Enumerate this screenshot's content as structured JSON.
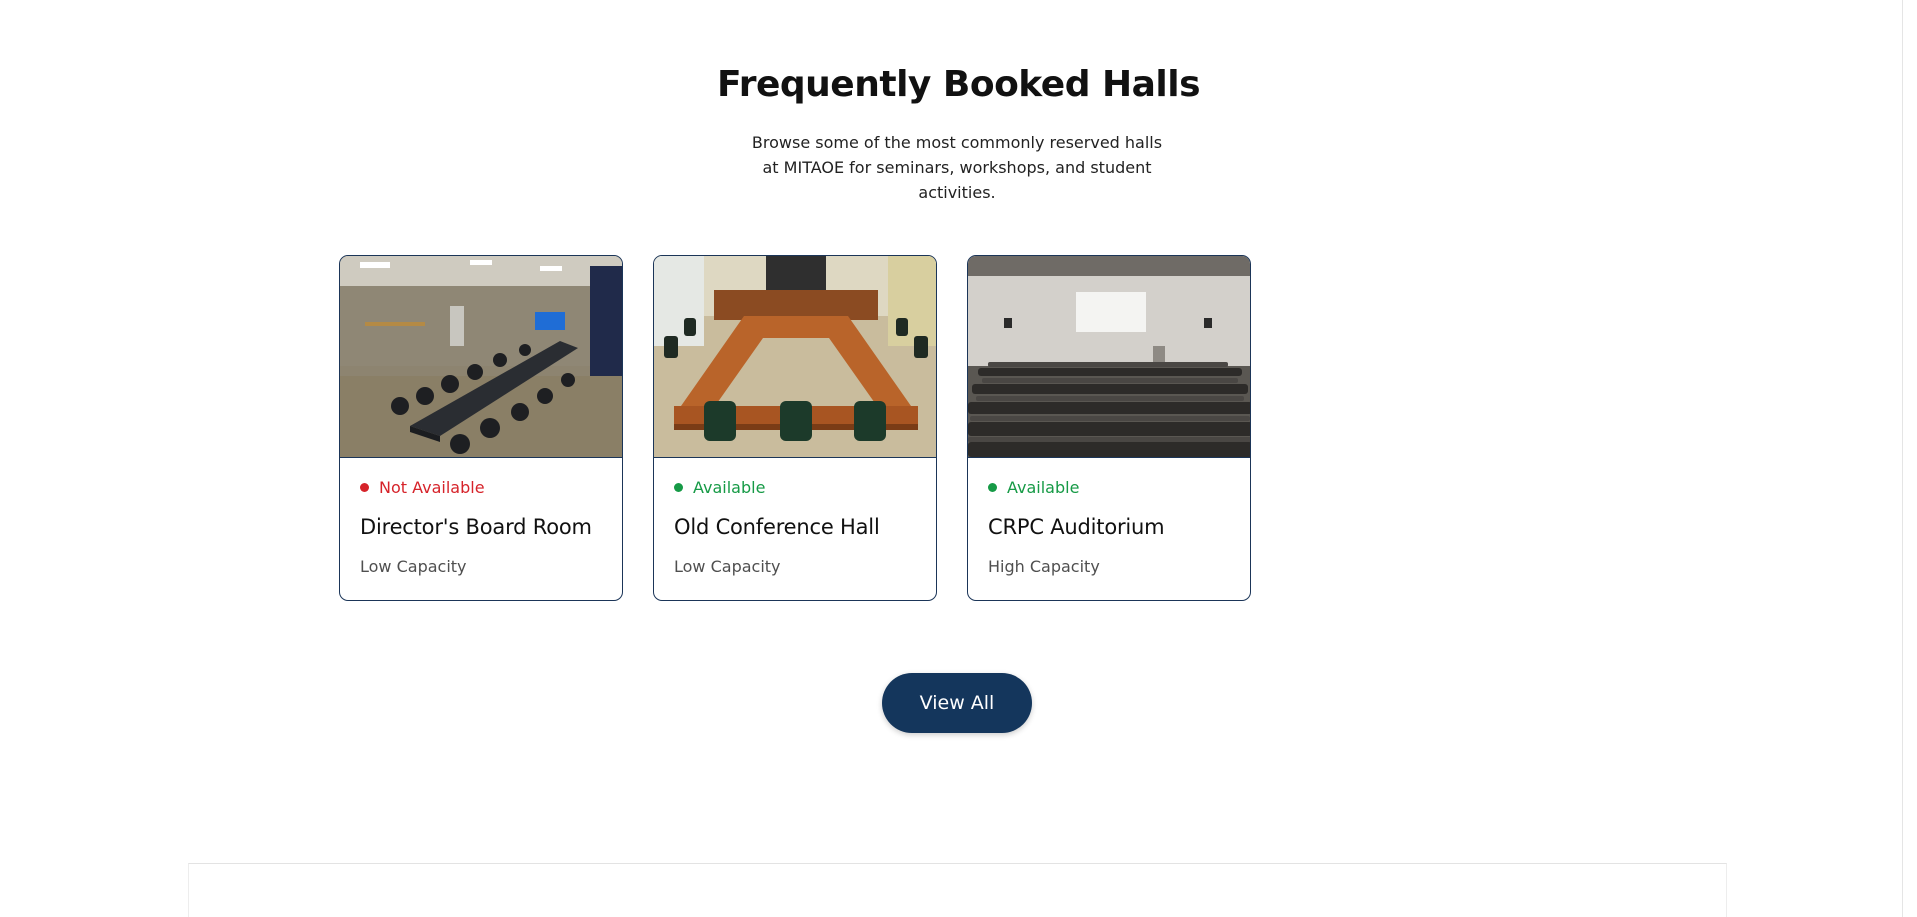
{
  "section": {
    "title": "Frequently Booked Halls",
    "subtitle": "Browse some of the most commonly reserved halls at MITAOE for seminars, workshops, and student activities."
  },
  "halls": [
    {
      "status": "Not Available",
      "status_color": "#d6232a",
      "name": "Director's Board Room",
      "capacity": "Low Capacity"
    },
    {
      "status": "Available",
      "status_color": "#169a46",
      "name": "Old Conference Hall",
      "capacity": "Low Capacity"
    },
    {
      "status": "Available",
      "status_color": "#169a46",
      "name": "CRPC Auditorium",
      "capacity": "High Capacity"
    }
  ],
  "actions": {
    "view_all_label": "View All"
  },
  "colors": {
    "primary": "#14365c",
    "card_border": "#1b3558"
  }
}
